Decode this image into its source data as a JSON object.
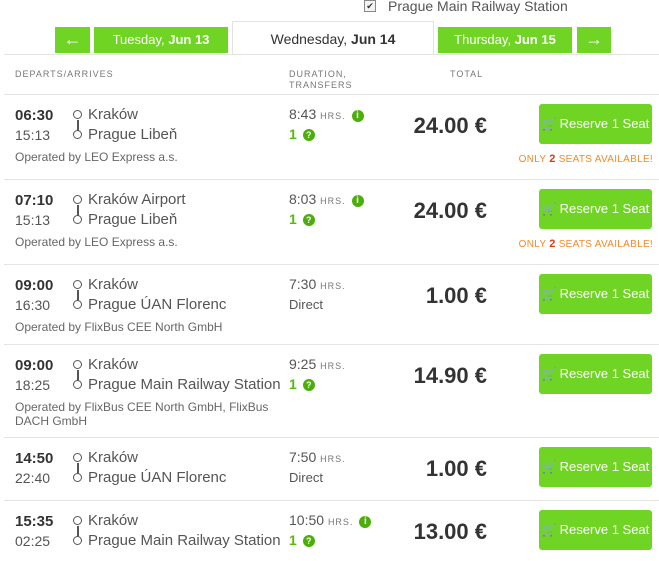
{
  "filter": {
    "checkbox_mark": "✔",
    "label": "Prague Main Railway Station"
  },
  "nav": {
    "prev_arrow": "←",
    "next_arrow": "→",
    "prev_day": {
      "weekday": "Tuesday, ",
      "date": "Jun 13"
    },
    "current_day": {
      "weekday": "Wednesday, ",
      "date": "Jun 14"
    },
    "next_day": {
      "weekday": "Thursday, ",
      "date": "Jun 15"
    }
  },
  "table": {
    "headers": {
      "departs": "DEPARTS/ARRIVES",
      "duration_line1": "DURATION,",
      "duration_line2": "TRANSFERS",
      "total": "TOTAL"
    },
    "rows": [
      {
        "dep_time": "06:30",
        "arr_time": "15:13",
        "from": "Kraków",
        "to": "Prague Libeň",
        "duration": "8:43",
        "hrs": "HRS.",
        "transfers": "1",
        "price": "24.00 €",
        "operator": "Operated by LEO Express a.s.",
        "seats_pre": "ONLY ",
        "seats_num": "2",
        "seats_post": " SEATS AVAILABLE!"
      },
      {
        "dep_time": "07:10",
        "arr_time": "15:13",
        "from": "Kraków Airport",
        "to": "Prague Libeň",
        "duration": "8:03",
        "hrs": "HRS.",
        "transfers": "1",
        "price": "24.00 €",
        "operator": "Operated by LEO Express a.s.",
        "seats_pre": "ONLY ",
        "seats_num": "2",
        "seats_post": " SEATS AVAILABLE!"
      },
      {
        "dep_time": "09:00",
        "arr_time": "16:30",
        "from": "Kraków",
        "to": "Prague ÚAN Florenc",
        "duration": "7:30",
        "hrs": "HRS.",
        "direct": "Direct",
        "price": "1.00 €",
        "operator": "Operated by FlixBus CEE North GmbH"
      },
      {
        "dep_time": "09:00",
        "arr_time": "18:25",
        "from": "Kraków",
        "to": "Prague Main Railway Station",
        "duration": "9:25",
        "hrs": "HRS.",
        "transfers": "1",
        "price": "14.90 €",
        "operator_line1": "Operated by FlixBus CEE North GmbH, FlixBus",
        "operator_line2": "DACH GmbH"
      },
      {
        "dep_time": "14:50",
        "arr_time": "22:40",
        "from": "Kraków",
        "to": "Prague ÚAN Florenc",
        "duration": "7:50",
        "hrs": "HRS.",
        "direct": "Direct",
        "price": "1.00 €"
      },
      {
        "dep_time": "15:35",
        "arr_time": "02:25",
        "from": "Kraków",
        "to": "Prague Main Railway Station",
        "duration": "10:50",
        "hrs": "HRS.",
        "transfers": "1",
        "price": "13.00 €"
      }
    ],
    "reserve_label": "Reserve 1 Seat",
    "cart_icon": "🛒",
    "info_glyph": "i",
    "help_glyph": "?"
  }
}
